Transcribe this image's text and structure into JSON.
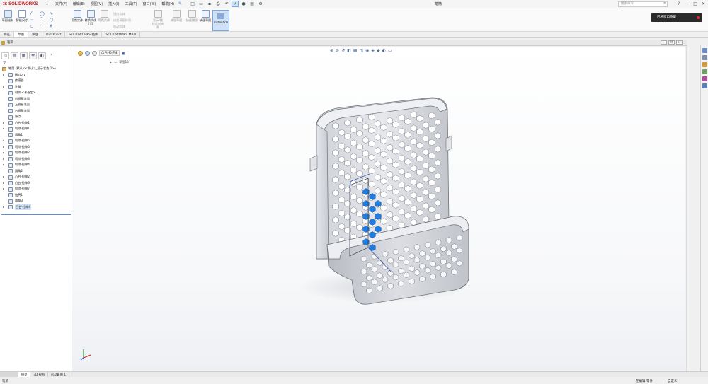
{
  "app": {
    "logo_ds": "3S",
    "logo_text": "SOLIDWORKS",
    "document_title": "笔筒"
  },
  "menu": [
    "文件(F)",
    "编辑(E)",
    "视图(V)",
    "插入(I)",
    "工具(T)",
    "窗口(W)",
    "帮助(H)"
  ],
  "search": {
    "placeholder": "搜索命令"
  },
  "command_manager": {
    "sketch_button": "草图绘制",
    "smart_dim_button": "智能尺寸",
    "trim_button": "剪裁实体",
    "convert_button": "转换实体引用",
    "offset_button": "等距实体",
    "mirror_items": [
      "镜向实体",
      "线性草图阵列",
      "移动实体"
    ],
    "display_rel_button": "显示/删除几何关系",
    "repair_button": "修复草图",
    "quick_snap_button": "快速捕捉",
    "rapid_sketch_button": "快速草图",
    "instant2d_button": "Instant2D"
  },
  "notice": {
    "text": "已将窗口隐藏"
  },
  "ribbon_tabs": [
    "特征",
    "草图",
    "评估",
    "DimXpert",
    "SOLIDWORKS 插件",
    "SOLIDWORKS MBD"
  ],
  "doc_window": {
    "title": "笔筒"
  },
  "tree": {
    "root": "笔筒 (默认<<默认>_显示状态 1>)",
    "items": [
      {
        "label": "History",
        "arrow": "▸"
      },
      {
        "label": "传感器",
        "arrow": ""
      },
      {
        "label": "注解",
        "arrow": "▸"
      },
      {
        "label": "材质 <未指定>",
        "arrow": ""
      },
      {
        "label": "前视基准面",
        "arrow": ""
      },
      {
        "label": "上视基准面",
        "arrow": ""
      },
      {
        "label": "右视基准面",
        "arrow": ""
      },
      {
        "label": "原点",
        "arrow": ""
      },
      {
        "label": "凸台-拉伸1",
        "arrow": "▸"
      },
      {
        "label": "切除-拉伸1",
        "arrow": "▸"
      },
      {
        "label": "圆角1",
        "arrow": ""
      },
      {
        "label": "切除-拉伸5",
        "arrow": "▸"
      },
      {
        "label": "切除-拉伸6",
        "arrow": "▸"
      },
      {
        "label": "切除-拉伸2",
        "arrow": "▸"
      },
      {
        "label": "切除-拉伸3",
        "arrow": "▸"
      },
      {
        "label": "切除-拉伸4",
        "arrow": "▸"
      },
      {
        "label": "圆角2",
        "arrow": ""
      },
      {
        "label": "凸台-拉伸2",
        "arrow": "▸"
      },
      {
        "label": "凸台-拉伸3",
        "arrow": "▸"
      },
      {
        "label": "切除-拉伸7",
        "arrow": "▸"
      },
      {
        "label": "抽壳1",
        "arrow": ""
      },
      {
        "label": "圆角3",
        "arrow": ""
      },
      {
        "label": "凸台-拉伸4",
        "arrow": "▸"
      }
    ]
  },
  "viewport": {
    "breadcrumb_feature": "凸台-拉伸4",
    "plane_label": "草图13"
  },
  "bottom_tabs": [
    "模型",
    "3D 视图",
    "运动算例 1"
  ],
  "status": {
    "left": "笔筒",
    "mid": "在编辑 零件",
    "right": "自定义"
  },
  "colors": {
    "brand_red": "#c8161d",
    "selection_blue": "#1f7de0",
    "part_gray": "#d9dbe0"
  }
}
